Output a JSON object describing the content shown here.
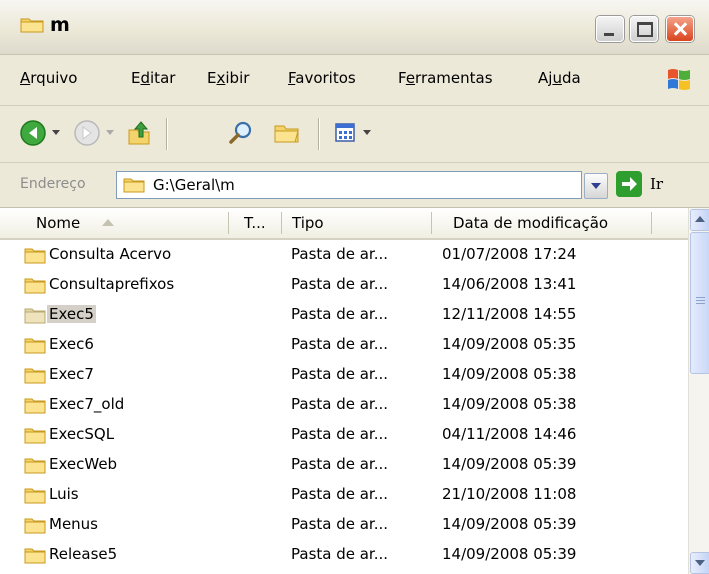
{
  "window": {
    "title": "m"
  },
  "menubar": {
    "items": [
      {
        "pre": "",
        "key": "A",
        "post": "rquivo"
      },
      {
        "pre": "E",
        "key": "d",
        "post": "itar"
      },
      {
        "pre": "E",
        "key": "x",
        "post": "ibir"
      },
      {
        "pre": "",
        "key": "F",
        "post": "avoritos"
      },
      {
        "pre": "F",
        "key": "e",
        "post": "rramentas"
      },
      {
        "pre": "Aj",
        "key": "u",
        "post": "da"
      }
    ]
  },
  "toolbar": {
    "icons": [
      "back-icon",
      "forward-icon",
      "up-folder-icon",
      "search-icon",
      "folders-icon",
      "views-icon"
    ]
  },
  "address": {
    "label": "Endereço",
    "value": "G:\\Geral\\m",
    "go_label": "Ir"
  },
  "columns": {
    "name": "Nome",
    "size": "T...",
    "type": "Tipo",
    "date": "Data de modificação"
  },
  "files": [
    {
      "name": "Consulta Acervo",
      "type": "Pasta de ar...",
      "date": "01/07/2008 17:24"
    },
    {
      "name": "Consultaprefixos",
      "type": "Pasta de ar...",
      "date": "14/06/2008 13:41"
    },
    {
      "name": "Exec5",
      "type": "Pasta de ar...",
      "date": "12/11/2008 14:55",
      "selected": true
    },
    {
      "name": "Exec6",
      "type": "Pasta de ar...",
      "date": "14/09/2008 05:35"
    },
    {
      "name": "Exec7",
      "type": "Pasta de ar...",
      "date": "14/09/2008 05:38"
    },
    {
      "name": "Exec7_old",
      "type": "Pasta de ar...",
      "date": "14/09/2008 05:38"
    },
    {
      "name": "ExecSQL",
      "type": "Pasta de ar...",
      "date": "04/11/2008 14:46"
    },
    {
      "name": "ExecWeb",
      "type": "Pasta de ar...",
      "date": "14/09/2008 05:39"
    },
    {
      "name": "Luis",
      "type": "Pasta de ar...",
      "date": "21/10/2008 11:08"
    },
    {
      "name": "Menus",
      "type": "Pasta de ar...",
      "date": "14/09/2008 05:39"
    },
    {
      "name": "Release5",
      "type": "Pasta de ar...",
      "date": "14/09/2008 05:39"
    }
  ],
  "colors": {
    "folder": "#f4d36a",
    "folder_dark": "#c89a1f",
    "selection": "#d4d0c8",
    "chrome": "#ece9d8"
  }
}
